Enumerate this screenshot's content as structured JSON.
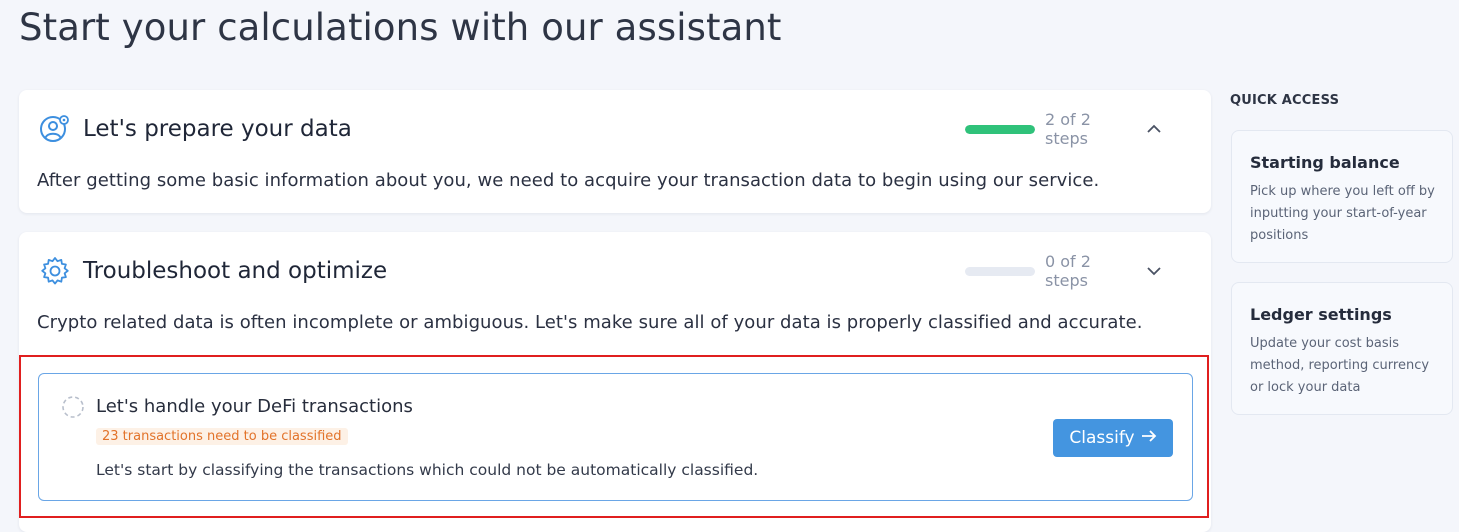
{
  "page": {
    "title": "Start your calculations with our assistant"
  },
  "sections": [
    {
      "title": "Let's prepare your data",
      "icon": "user-settings-icon",
      "progress_fraction": 1.0,
      "steps_text": "2 of 2 steps",
      "expanded": true,
      "description": "After getting some basic information about you, we need to acquire your transaction data to begin using our service."
    },
    {
      "title": "Troubleshoot and optimize",
      "icon": "gear-icon",
      "progress_fraction": 0.0,
      "steps_text": "0 of 2 steps",
      "expanded": false,
      "description": "Crypto related data is often incomplete or ambiguous. Let's make sure all of your data is properly classified and accurate."
    }
  ],
  "task": {
    "title": "Let's handle your DeFi transactions",
    "badge": "23 transactions need to be classified",
    "description": "Let's start by classifying the transactions which could not be automatically classified.",
    "button_label": "Classify",
    "status": "pending"
  },
  "quick_access": {
    "heading": "QUICK ACCESS",
    "items": [
      {
        "title": "Starting balance",
        "description": "Pick up where you left off by inputting your start-of-year positions"
      },
      {
        "title": "Ledger settings",
        "description": "Update your cost basis method, reporting currency or lock your data"
      }
    ]
  },
  "colors": {
    "accent": "#4495e0",
    "progress_complete": "#2fc27a",
    "badge_text": "#e2732a",
    "highlight": "#e01f1f"
  }
}
